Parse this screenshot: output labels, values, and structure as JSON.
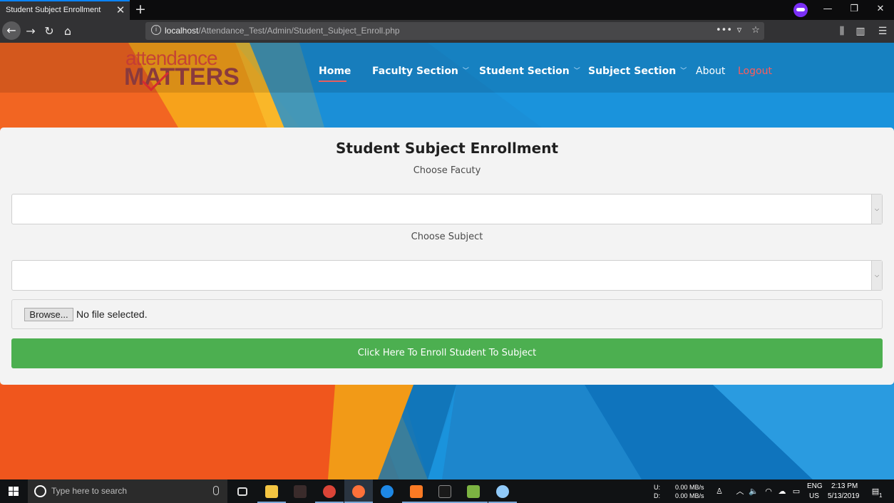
{
  "browser": {
    "tab_title": "Student Subject Enrollment",
    "tab_close": "✕",
    "new_tab": "+",
    "url_host": "localhost",
    "url_path": "/Attendance_Test/Admin/Student_Subject_Enroll.php",
    "window_controls": {
      "minimize": "—",
      "restore": "❐",
      "close": "✕"
    },
    "icons": [
      "back-icon",
      "forward-icon",
      "reload-icon",
      "home-icon",
      "site-info-icon",
      "page-actions-icon",
      "pocket-icon",
      "bookmark-star-icon",
      "library-icon",
      "sidebar-icon",
      "menu-icon"
    ]
  },
  "site": {
    "logo": {
      "top": "attendance",
      "bottom": "MATTERS"
    },
    "nav": {
      "home": "Home",
      "faculty": "Faculty Section",
      "student": "Student Section",
      "subject": "Subject Section",
      "about": "About",
      "logout": "Logout"
    },
    "colors": {
      "accent_green": "#4caf50",
      "logout_red": "#ff5b5b",
      "underline": "#e95e5e"
    }
  },
  "form": {
    "title": "Student Subject Enrollment",
    "faculty_label": "Choose Facuty",
    "faculty_value": "",
    "subject_label": "Choose Subject",
    "subject_value": "",
    "browse_label": "Browse...",
    "file_status": "No file selected.",
    "submit_label": "Click Here To Enroll Student To Subject"
  },
  "taskbar": {
    "search_placeholder": "Type here to search",
    "net_up_label": "U:",
    "net_down_label": "D:",
    "net_up": "0.00 MB/s",
    "net_down": "0.00 MB/s",
    "lang": "ENG",
    "region": "US",
    "time": "2:13 PM",
    "date": "5/13/2019",
    "notifications": "1"
  }
}
